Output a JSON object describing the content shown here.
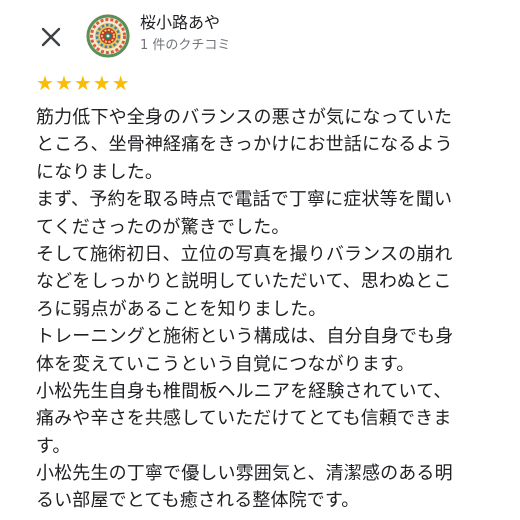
{
  "header": {
    "close_icon": "close-icon",
    "reviewer_name": "桜小路あや",
    "review_count": "1 件のクチコミ",
    "avatar_icon": "mandala-avatar"
  },
  "rating": {
    "stars": 5,
    "max": 5,
    "star_color": "#fbbc04"
  },
  "review": {
    "lines": [
      "筋力低下や全身のバランスの悪さが気になっていた",
      "ところ、坐骨神経痛をきっかけにお世話になるよう",
      "になりました。",
      "まず、予約を取る時点で電話で丁寧に症状等を聞い",
      "てくださったのが驚きでした。",
      "そして施術初日、立位の写真を撮りバランスの崩れ",
      "などをしっかりと説明していただいて、思わぬとこ",
      "ろに弱点があることを知りました。",
      "トレーニングと施術という構成は、自分自身でも身",
      "体を変えていこうという自覚につながります。",
      "小松先生自身も椎間板ヘルニアを経験されていて、",
      "痛みや辛さを共感していただけてとても信頼できま",
      "す。",
      "小松先生の丁寧で優しい雰囲気と、清潔感のある明",
      "るい部屋でとても癒される整体院です。"
    ]
  }
}
